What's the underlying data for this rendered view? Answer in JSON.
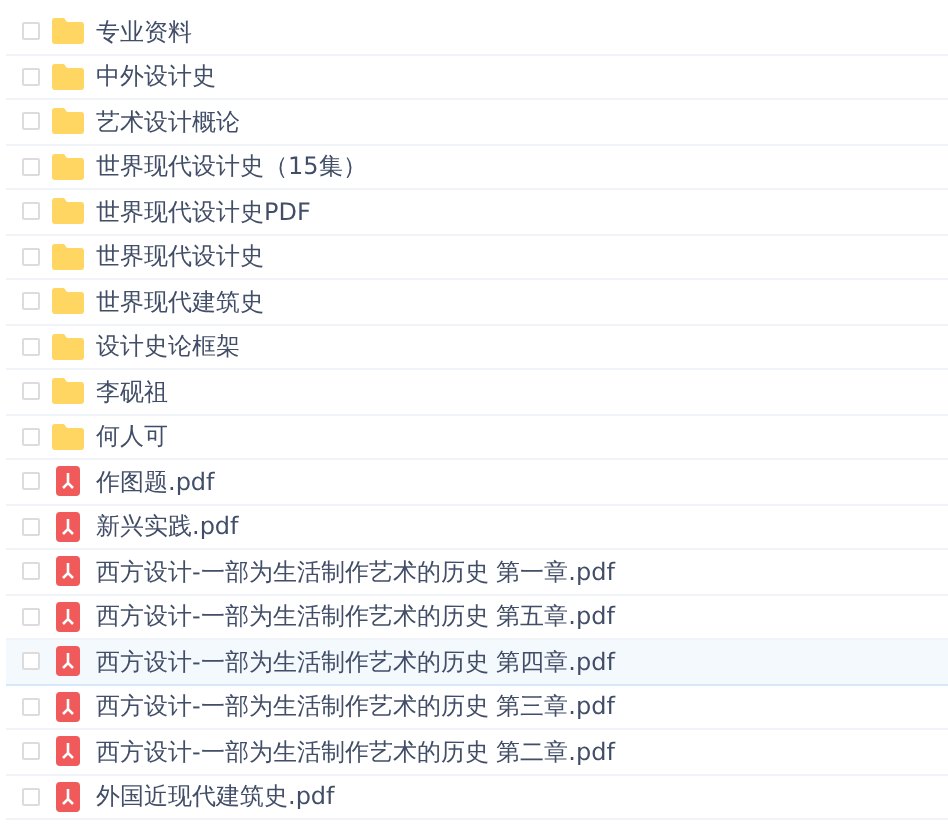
{
  "files": [
    {
      "kind": "folder",
      "name": "专业资料",
      "checked": false,
      "highlighted": false
    },
    {
      "kind": "folder",
      "name": "中外设计史",
      "checked": false,
      "highlighted": false
    },
    {
      "kind": "folder",
      "name": "艺术设计概论",
      "checked": false,
      "highlighted": false
    },
    {
      "kind": "folder",
      "name": "世界现代设计史（15集）",
      "checked": false,
      "highlighted": false
    },
    {
      "kind": "folder",
      "name": "世界现代设计史PDF",
      "checked": false,
      "highlighted": false
    },
    {
      "kind": "folder",
      "name": "世界现代设计史",
      "checked": false,
      "highlighted": false
    },
    {
      "kind": "folder",
      "name": "世界现代建筑史",
      "checked": false,
      "highlighted": false
    },
    {
      "kind": "folder",
      "name": "设计史论框架",
      "checked": false,
      "highlighted": false
    },
    {
      "kind": "folder",
      "name": "李砚祖",
      "checked": false,
      "highlighted": false
    },
    {
      "kind": "folder",
      "name": "何人可",
      "checked": false,
      "highlighted": false
    },
    {
      "kind": "pdf",
      "name": "作图题.pdf",
      "checked": false,
      "highlighted": false
    },
    {
      "kind": "pdf",
      "name": "新兴实践.pdf",
      "checked": false,
      "highlighted": false
    },
    {
      "kind": "pdf",
      "name": "西方设计-一部为生活制作艺术的历史 第一章.pdf",
      "checked": false,
      "highlighted": false
    },
    {
      "kind": "pdf",
      "name": "西方设计-一部为生活制作艺术的历史 第五章.pdf",
      "checked": false,
      "highlighted": false
    },
    {
      "kind": "pdf",
      "name": "西方设计-一部为生活制作艺术的历史 第四章.pdf",
      "checked": false,
      "highlighted": true
    },
    {
      "kind": "pdf",
      "name": "西方设计-一部为生活制作艺术的历史 第三章.pdf",
      "checked": false,
      "highlighted": false
    },
    {
      "kind": "pdf",
      "name": "西方设计-一部为生活制作艺术的历史 第二章.pdf",
      "checked": false,
      "highlighted": false
    },
    {
      "kind": "pdf",
      "name": "外国近现代建筑史.pdf",
      "checked": false,
      "highlighted": false
    }
  ]
}
